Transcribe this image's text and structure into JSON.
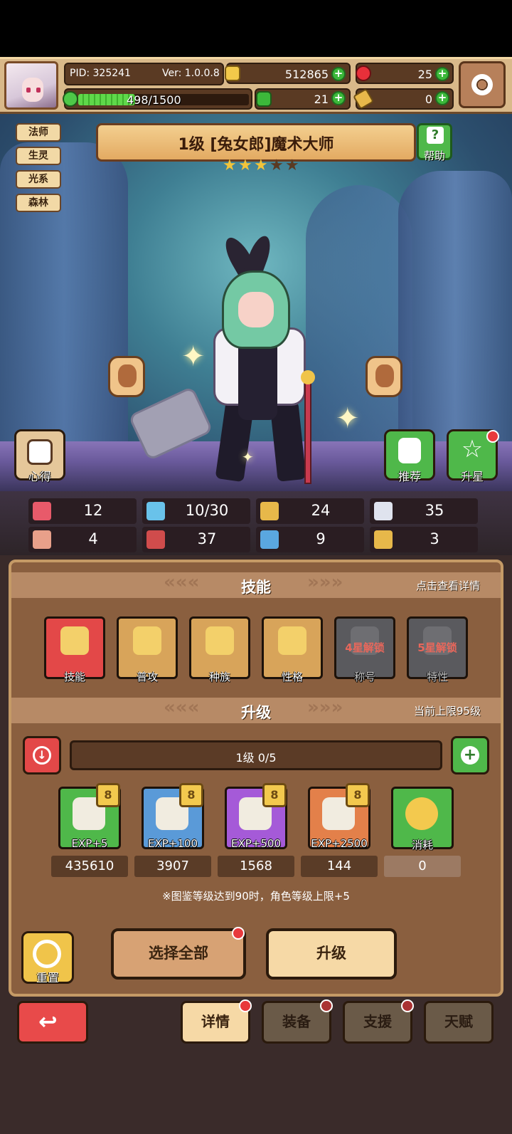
{
  "header": {
    "pid": "PID: 325241",
    "version": "Ver: 1.0.0.8",
    "exp_text": "498/1500",
    "exp_fraction": 0.332,
    "gold": "512865",
    "red_gems": "25",
    "clover": "21",
    "key_items": "0"
  },
  "tags": [
    "法师",
    "生灵",
    "光系",
    "森林"
  ],
  "character": {
    "title": "1级 [兔女郎]魔术大师",
    "stars_filled": 3,
    "stars_total": 5,
    "star_glyph": "★"
  },
  "buttons": {
    "help": "帮助",
    "insight": "心得",
    "recommend": "推荐",
    "star_up": "升星"
  },
  "stats": [
    {
      "icon": "heart-icon",
      "value": "12",
      "color": "#e85a6a"
    },
    {
      "icon": "water-drop-icon",
      "value": "10/30",
      "color": "#69c2ea"
    },
    {
      "icon": "shield-icon",
      "value": "24",
      "color": "#e7b84a"
    },
    {
      "icon": "wing-icon",
      "value": "35",
      "color": "#dfe3ee"
    },
    {
      "icon": "fist-icon",
      "value": "4",
      "color": "#e8a08a"
    },
    {
      "icon": "book-icon",
      "value": "37",
      "color": "#d04c4c"
    },
    {
      "icon": "boot-icon",
      "value": "9",
      "color": "#5aa7e0"
    },
    {
      "icon": "horseshoe-icon",
      "value": "3",
      "color": "#e7b84a"
    }
  ],
  "skills_section": {
    "title": "技能",
    "note": "点击查看详情",
    "items": [
      {
        "label": "技能",
        "locked": false,
        "lock_text": ""
      },
      {
        "label": "普攻",
        "locked": false,
        "lock_text": ""
      },
      {
        "label": "种族",
        "locked": false,
        "lock_text": ""
      },
      {
        "label": "性格",
        "locked": false,
        "lock_text": ""
      },
      {
        "label": "称号",
        "locked": true,
        "lock_text": "4星解锁"
      },
      {
        "label": "特性",
        "locked": true,
        "lock_text": "5星解锁"
      }
    ]
  },
  "upgrade_section": {
    "title": "升级",
    "note": "当前上限95级",
    "level_text": "1级 0/5",
    "badge": "8",
    "items": [
      {
        "label": "EXP+5",
        "count": "435610"
      },
      {
        "label": "EXP+100",
        "count": "3907"
      },
      {
        "label": "EXP+500",
        "count": "1568"
      },
      {
        "label": "EXP+2500",
        "count": "144"
      },
      {
        "label": "消耗",
        "count": "0"
      }
    ],
    "footnote": "※图鉴等级达到90时，角色等级上限+5"
  },
  "actions": {
    "reset": "重置",
    "select_all": "选择全部",
    "level_up": "升级"
  },
  "tabs": [
    "详情",
    "装备",
    "支援",
    "天赋"
  ]
}
